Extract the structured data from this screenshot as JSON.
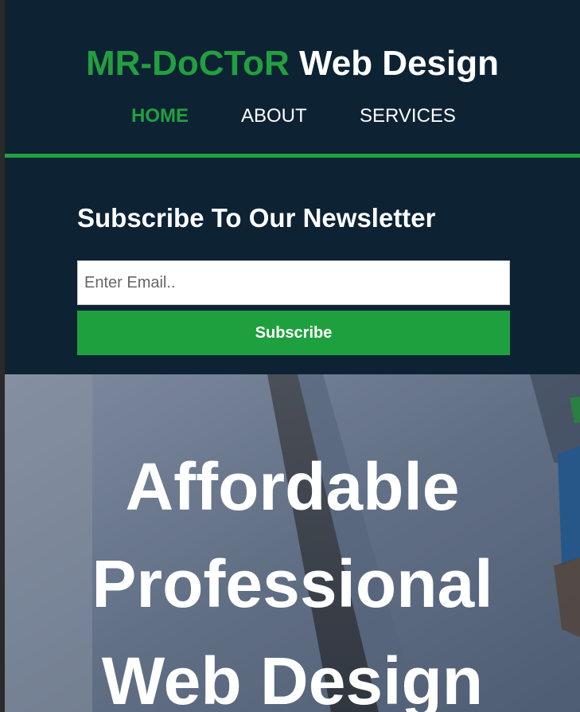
{
  "header": {
    "logo_brand": "MR-DoCToR",
    "logo_rest": " Web Design",
    "nav": {
      "home": "HOME",
      "about": "ABOUT",
      "services": "SERVICES"
    }
  },
  "newsletter": {
    "title": "Subscribe To Our Newsletter",
    "email_placeholder": "Enter Email..",
    "button_label": "Subscribe"
  },
  "hero": {
    "title_line1": "Affordable",
    "title_line2": "Professional",
    "title_line3": "Web Design"
  },
  "colors": {
    "accent": "#22a03f",
    "dark_bg": "#0d2233",
    "text": "#ffffff"
  }
}
